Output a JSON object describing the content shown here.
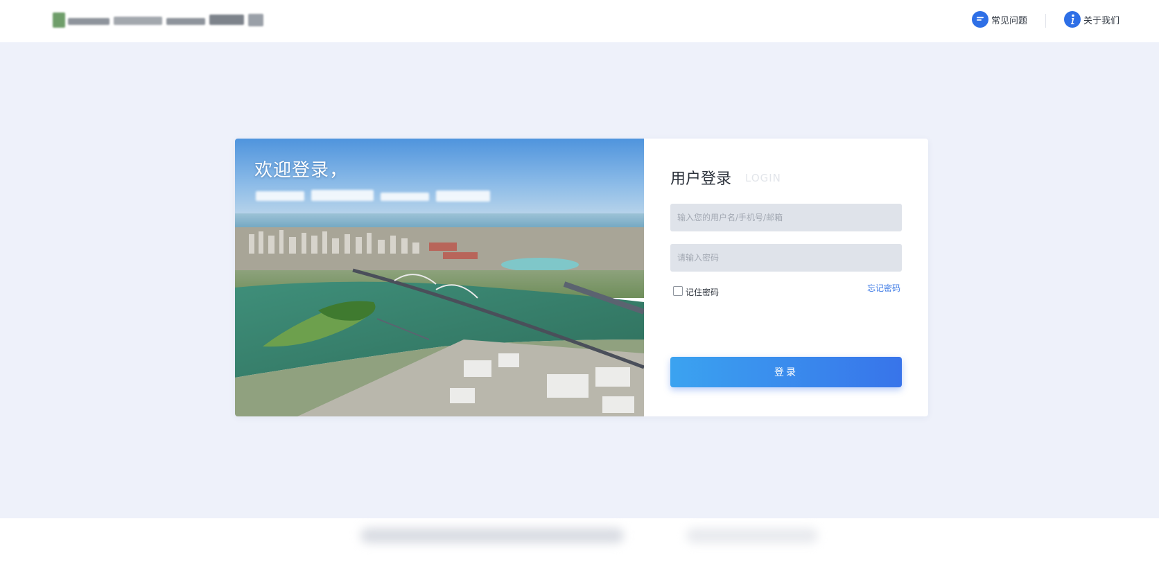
{
  "header": {
    "nav": [
      {
        "label": "常见问题",
        "icon": "chat-bubble-icon"
      },
      {
        "label": "关于我们",
        "icon": "info-icon"
      }
    ]
  },
  "hero": {
    "title": "欢迎登录，"
  },
  "login": {
    "title": "用户登录",
    "title_en": "LOGIN",
    "username_placeholder": "输入您的用户名/手机号/邮箱",
    "password_placeholder": "请输入密码",
    "remember_label": "记住密码",
    "remember_checked": false,
    "forgot_label": "忘记密码",
    "submit_label": "登录"
  },
  "colors": {
    "accent": "#3874ea",
    "accent_start": "#3ba3f0",
    "page_bg": "#eef1fa",
    "link": "#3d7ae6"
  }
}
